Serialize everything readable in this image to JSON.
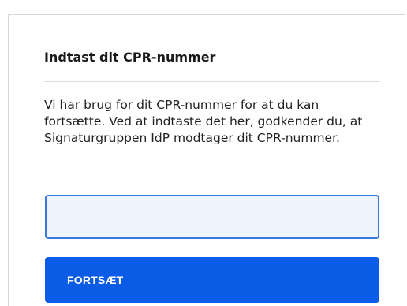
{
  "card": {
    "title": "Indtast dit CPR-nummer",
    "description": "Vi har brug for dit CPR-nummer for at du kan fortsætte. Ved at indtaste det her, godkender du, at Signaturgruppen IdP modtager dit CPR-nummer.",
    "cpr_input": {
      "value": "",
      "placeholder": ""
    },
    "submit_label": "FORTSÆT"
  },
  "colors": {
    "accent": "#0a5ce6",
    "input_border": "#3a78e0",
    "input_background": "#eef3fc",
    "card_border": "#d8d8d8"
  }
}
